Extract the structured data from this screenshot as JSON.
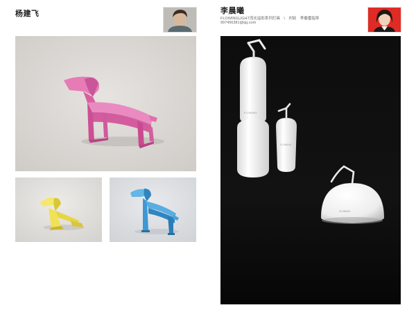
{
  "left": {
    "designer_name": "杨建飞",
    "photos": [
      {
        "subject": "pink-dog-chair",
        "background": "#dcd9d6",
        "accent": "#e36fae"
      },
      {
        "subject": "yellow-dog",
        "background": "#e5e5e3",
        "accent": "#f3e35a"
      },
      {
        "subject": "blue-dog",
        "background": "#dee1e4",
        "accent": "#4aa3d8"
      }
    ]
  },
  "right": {
    "designer_name": "李晨曦",
    "project_line": "FLOWINGLIGHT流光溢彩系列灯具　\\　刘钦　李春雷指导",
    "email": "997456381@qq.com",
    "brand_on_product": "FLOWING",
    "photo": {
      "subject": "white-lamp-series",
      "background": "#0b0b0b"
    }
  }
}
